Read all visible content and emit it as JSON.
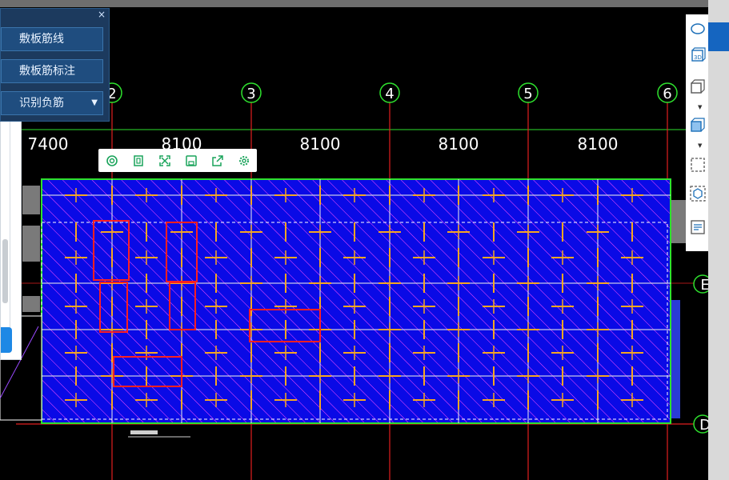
{
  "panel": {
    "btn1": "敷板筋线",
    "btn2": "敷板筋标注",
    "btn3": "识别负筋",
    "close": "×"
  },
  "dialog": {
    "close": "✕"
  },
  "axes": [
    {
      "label": "2"
    },
    {
      "label": "3"
    },
    {
      "label": "4"
    },
    {
      "label": "5"
    },
    {
      "label": "6"
    }
  ],
  "dims": [
    "7400",
    "8100",
    "8100",
    "8100",
    "8100"
  ],
  "row_axes": [
    "E",
    "D"
  ],
  "minibar_icons": [
    "zoom-rotate-icon",
    "copy-icon",
    "fullscreen-icon",
    "save-icon",
    "export-icon",
    "settings-icon"
  ],
  "right_tools": [
    "ellipse-icon",
    "view-3d-icon",
    "box-icon",
    "solid-box-icon",
    "select-region-icon",
    "cube-select-icon",
    "properties-list-icon"
  ],
  "colors": {
    "slab": "#0a0ae6",
    "hatch": "#ff4dff",
    "grid_green": "#2ee12e",
    "axis_red": "#e11f1f",
    "highlight": "#ff2020"
  }
}
